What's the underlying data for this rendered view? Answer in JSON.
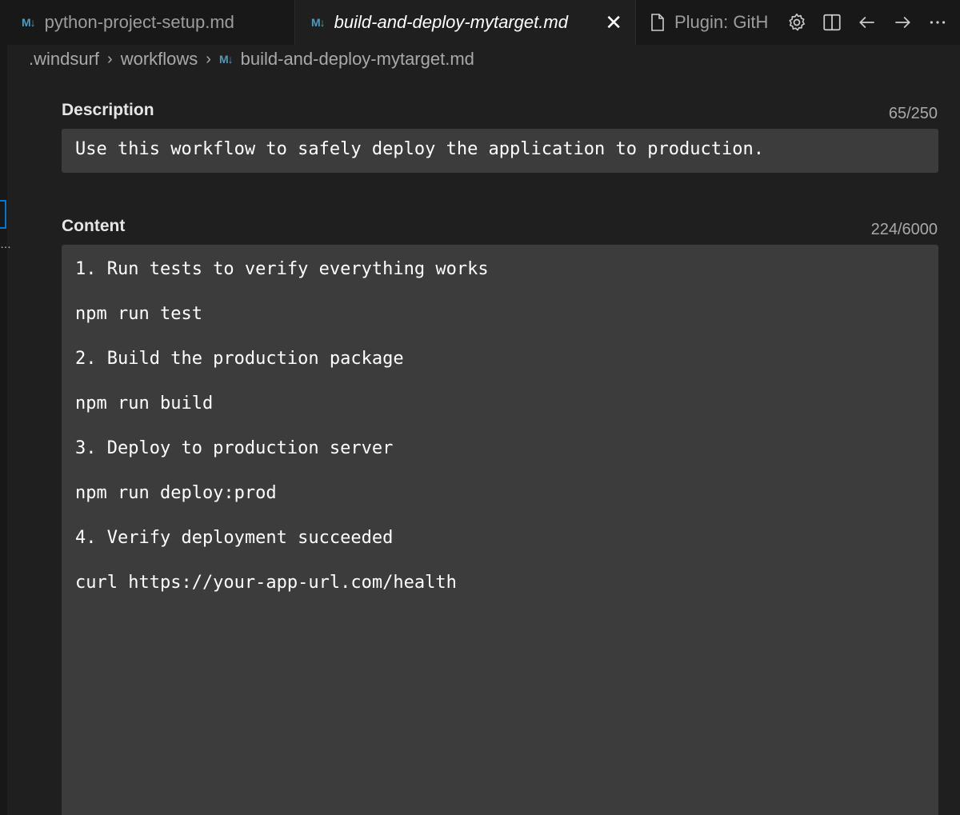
{
  "tabs": [
    {
      "label": "python-project-setup.md",
      "icon": "markdown-icon",
      "active": false
    },
    {
      "label": "build-and-deploy-mytarget.md",
      "icon": "markdown-icon",
      "active": true
    },
    {
      "label": "Plugin: GitH",
      "icon": "file-icon",
      "active": false
    }
  ],
  "tab_icon_text": "M↓",
  "close_glyph": "✕",
  "breadcrumb": {
    "items": [
      ".windsurf",
      "workflows",
      "build-and-deploy-mytarget.md"
    ],
    "separator": "›"
  },
  "description": {
    "label": "Description",
    "counter": "65/250",
    "value": "Use this workflow to safely deploy the application to production."
  },
  "content": {
    "label": "Content",
    "counter": "224/6000",
    "lines": [
      "1. Run tests to verify everything works",
      "npm run test",
      "2. Build the production package",
      "npm run build",
      "3. Deploy to production server",
      "npm run deploy:prod",
      "4. Verify deployment succeeded",
      "curl https://your-app-url.com/health"
    ]
  },
  "left_gutter_glyph": "…",
  "colors": {
    "accent": "#0078d4",
    "markdown_icon": "#519aba",
    "editor_bg": "#1f1f1f",
    "input_bg": "#3c3c3c"
  }
}
